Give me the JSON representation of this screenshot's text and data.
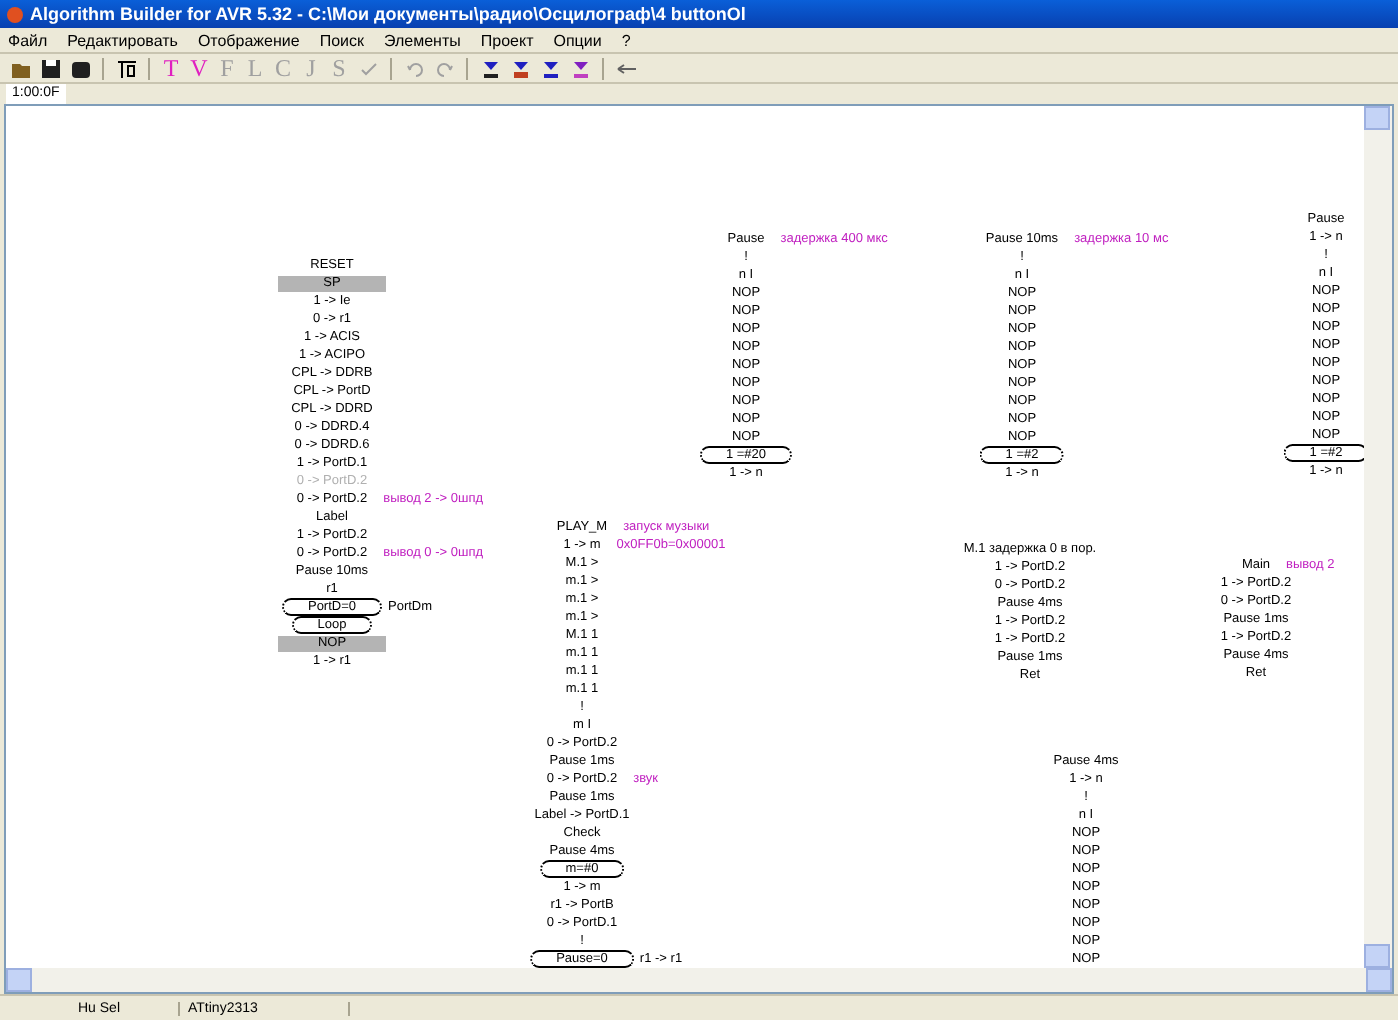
{
  "window": {
    "title": "Algorithm Builder for AVR 5.32 - C:\\Мои документы\\радио\\Осцилограф\\4 buttonOl"
  },
  "menu": [
    "Файл",
    "Редактировать",
    "Отображение",
    "Поиск",
    "Элементы",
    "Проект",
    "Опции",
    "?"
  ],
  "toolbar_letters": [
    {
      "label": "T",
      "disabled": false
    },
    {
      "label": "V",
      "disabled": false
    },
    {
      "label": "F",
      "disabled": true
    },
    {
      "label": "L",
      "disabled": true
    },
    {
      "label": "C",
      "disabled": true
    },
    {
      "label": "J",
      "disabled": true
    },
    {
      "label": "S",
      "disabled": true
    }
  ],
  "tabs": [
    {
      "label": "1:00:0F",
      "selected": true
    }
  ],
  "blocks": [
    {
      "label": "RESET",
      "lines": [
        {
          "kind": "header",
          "text": "SP"
        },
        {
          "kind": "op",
          "text": "1 -> Ie"
        },
        {
          "kind": "op",
          "text": "0 -> r1"
        },
        {
          "kind": "op",
          "text": "1 -> ACIS"
        },
        {
          "kind": "op",
          "text": "1 -> ACIPO"
        },
        {
          "kind": "op",
          "text": "CPL -> DDRB"
        },
        {
          "kind": "op",
          "text": "CPL -> PortD"
        },
        {
          "kind": "op",
          "text": "CPL -> DDRD"
        },
        {
          "kind": "op",
          "text": "0 -> DDRD.4"
        },
        {
          "kind": "op",
          "text": "0 -> DDRD.6"
        },
        {
          "kind": "op",
          "text": "1 -> PortD.1"
        },
        {
          "kind": "disabled",
          "text": "0 -> PortD.2"
        },
        {
          "kind": "op",
          "text": "0 -> PortD.2",
          "comment": "вывод 2 -> 0шпд"
        },
        {
          "kind": "op",
          "text": "Label"
        },
        {
          "kind": "op",
          "text": "1 -> PortD.2"
        },
        {
          "kind": "op",
          "text": "0 -> PortD.2",
          "comment": "вывод 0 -> 0шпд"
        },
        {
          "kind": "op",
          "text": "Pause 10ms"
        },
        {
          "kind": "op",
          "text": "r1"
        },
        {
          "kind": "condition",
          "text": "PortD=0",
          "side": "PortDm"
        },
        {
          "kind": "condition",
          "text": "Loop"
        },
        {
          "kind": "header",
          "text": "NOP"
        },
        {
          "kind": "op",
          "text": "1 -> r1"
        }
      ]
    },
    {
      "label": "Pause",
      "comment": "задержка 400 мкс",
      "lines": [
        {
          "kind": "op",
          "text": "!"
        },
        {
          "kind": "op",
          "text": "n I"
        },
        {
          "kind": "op",
          "text": "NOP"
        },
        {
          "kind": "op",
          "text": "NOP"
        },
        {
          "kind": "op",
          "text": "NOP"
        },
        {
          "kind": "op",
          "text": "NOP"
        },
        {
          "kind": "op",
          "text": "NOP"
        },
        {
          "kind": "op",
          "text": "NOP"
        },
        {
          "kind": "op",
          "text": "NOP"
        },
        {
          "kind": "op",
          "text": "NOP"
        },
        {
          "kind": "op",
          "text": "NOP"
        },
        {
          "kind": "condition",
          "text": "1 =#20"
        },
        {
          "kind": "op",
          "text": "1 -> n"
        }
      ]
    },
    {
      "label": "Pause 10ms",
      "comment": "задержка 10 мс",
      "lines": [
        {
          "kind": "op",
          "text": "!"
        },
        {
          "kind": "op",
          "text": "n I"
        },
        {
          "kind": "op",
          "text": "NOP"
        },
        {
          "kind": "op",
          "text": "NOP"
        },
        {
          "kind": "op",
          "text": "NOP"
        },
        {
          "kind": "op",
          "text": "NOP"
        },
        {
          "kind": "op",
          "text": "NOP"
        },
        {
          "kind": "op",
          "text": "NOP"
        },
        {
          "kind": "op",
          "text": "NOP"
        },
        {
          "kind": "op",
          "text": "NOP"
        },
        {
          "kind": "op",
          "text": "NOP"
        },
        {
          "kind": "condition",
          "text": "1 =#2"
        },
        {
          "kind": "op",
          "text": "1 -> n"
        }
      ]
    },
    {
      "label": "Pause",
      "lines": [
        {
          "kind": "op",
          "text": "1 -> n"
        },
        {
          "kind": "op",
          "text": "!"
        },
        {
          "kind": "op",
          "text": "n I"
        },
        {
          "kind": "op",
          "text": "NOP"
        },
        {
          "kind": "op",
          "text": "NOP"
        },
        {
          "kind": "op",
          "text": "NOP"
        },
        {
          "kind": "op",
          "text": "NOP"
        },
        {
          "kind": "op",
          "text": "NOP"
        },
        {
          "kind": "op",
          "text": "NOP"
        },
        {
          "kind": "op",
          "text": "NOP"
        },
        {
          "kind": "op",
          "text": "NOP"
        },
        {
          "kind": "op",
          "text": "NOP"
        },
        {
          "kind": "condition",
          "text": "1 =#2"
        },
        {
          "kind": "op",
          "text": "1 -> n"
        }
      ]
    },
    {
      "label": "PLAY_M",
      "comment": "запуск музыки",
      "lines": [
        {
          "kind": "op",
          "text": "1 -> m",
          "comment": "0x0FF0b=0x00001"
        },
        {
          "kind": "op",
          "text": "M.1 >"
        },
        {
          "kind": "op",
          "text": "m.1 >"
        },
        {
          "kind": "op",
          "text": "m.1 >"
        },
        {
          "kind": "op",
          "text": "m.1 >"
        },
        {
          "kind": "op",
          "text": "M.1 1"
        },
        {
          "kind": "op",
          "text": "m.1 1"
        },
        {
          "kind": "op",
          "text": "m.1 1"
        },
        {
          "kind": "op",
          "text": "m.1 1"
        },
        {
          "kind": "op",
          "text": "!"
        },
        {
          "kind": "op",
          "text": "m I"
        },
        {
          "kind": "op",
          "text": "0 -> PortD.2"
        },
        {
          "kind": "op",
          "text": "Pause 1ms"
        },
        {
          "kind": "op",
          "text": "0 -> PortD.2",
          "comment": "звук"
        },
        {
          "kind": "op",
          "text": "Pause 1ms"
        },
        {
          "kind": "op",
          "text": "Label -> PortD.1"
        },
        {
          "kind": "op",
          "text": "Check"
        },
        {
          "kind": "op",
          "text": "Pause 4ms"
        },
        {
          "kind": "condition",
          "text": "m=#0"
        },
        {
          "kind": "op",
          "text": "1 -> m"
        },
        {
          "kind": "op",
          "text": "r1 -> PortB"
        },
        {
          "kind": "op",
          "text": "0 -> PortD.1"
        },
        {
          "kind": "op",
          "text": "!"
        },
        {
          "kind": "condition",
          "text": "Pause=0",
          "side": "r1 -> r1"
        }
      ]
    },
    {
      "label": "M.1 задержка 0 в пор.",
      "lines": [
        {
          "kind": "op",
          "text": "1 -> PortD.2"
        },
        {
          "kind": "op",
          "text": "0 -> PortD.2"
        },
        {
          "kind": "op",
          "text": "Pause 4ms"
        },
        {
          "kind": "op",
          "text": "1 -> PortD.2"
        },
        {
          "kind": "op",
          "text": "1 -> PortD.2"
        },
        {
          "kind": "op",
          "text": "Pause 1ms"
        },
        {
          "kind": "op",
          "text": "Ret"
        }
      ]
    },
    {
      "label": "Main",
      "comment": "вывод 2",
      "lines": [
        {
          "kind": "op",
          "text": "1 -> PortD.2"
        },
        {
          "kind": "op",
          "text": "0 -> PortD.2"
        },
        {
          "kind": "op",
          "text": "Pause 1ms"
        },
        {
          "kind": "op",
          "text": "1 -> PortD.2"
        },
        {
          "kind": "op",
          "text": "Pause 4ms"
        },
        {
          "kind": "op",
          "text": "Ret"
        }
      ]
    },
    {
      "label": "Pause 4ms",
      "lines": [
        {
          "kind": "op",
          "text": "1 -> n"
        },
        {
          "kind": "op",
          "text": "!"
        },
        {
          "kind": "op",
          "text": "n I"
        },
        {
          "kind": "op",
          "text": "NOP"
        },
        {
          "kind": "op",
          "text": "NOP"
        },
        {
          "kind": "op",
          "text": "NOP"
        },
        {
          "kind": "op",
          "text": "NOP"
        },
        {
          "kind": "op",
          "text": "NOP"
        },
        {
          "kind": "op",
          "text": "NOP"
        },
        {
          "kind": "op",
          "text": "NOP"
        },
        {
          "kind": "op",
          "text": "NOP"
        }
      ]
    }
  ],
  "status_bar": [
    "Hu Sel",
    "ATtiny2313"
  ]
}
